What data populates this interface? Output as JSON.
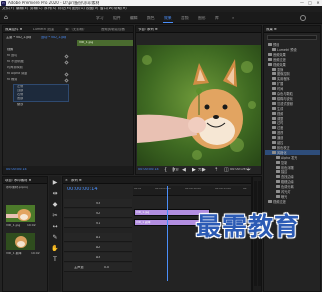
{
  "window": {
    "title": "Adobe Premiere Pro 2020 - D:\\pr\\备份\\水印素材",
    "controls": [
      "—",
      "□",
      "✕"
    ]
  },
  "menu": [
    "文件(F)",
    "编辑(E)",
    "剪辑(C)",
    "序列(S)",
    "标记(M)",
    "图形(G)",
    "视图(V)",
    "窗口(W)",
    "帮助(H)"
  ],
  "workspaces": {
    "items": [
      "学习",
      "组件",
      "编辑",
      "颜色",
      "效果",
      "音频",
      "图形",
      "库"
    ],
    "active_index": 4,
    "more": "»"
  },
  "effect_controls": {
    "tabs": [
      "效果控件 ≡",
      "Lumetri 范围",
      "源:（无剪辑）",
      "音频剪辑混合器"
    ],
    "header_source": "主要 * VID_1.jpg",
    "header_clip": "运动 * VID_1.jpg",
    "mini_clip": "VID_1.jpg",
    "sections": [
      {
        "label": "视频"
      },
      {
        "label": "fx 运动"
      },
      {
        "label": "fx 不透明度"
      },
      {
        "label": "时间重映射"
      },
      {
        "label": "fx Alpha 调整"
      },
      {
        "label": "fx 裁剪"
      },
      {
        "label": "左侧"
      },
      {
        "label": "顶部"
      },
      {
        "label": "右侧"
      },
      {
        "label": "底部"
      },
      {
        "label": "缩放"
      }
    ],
    "timecode": "00:00:00:14"
  },
  "program": {
    "tab": "节目: 序列 ≡",
    "timecode": "00:00:00:14",
    "fit": "适合",
    "quality": "完整",
    "duration": "00:00:19:02"
  },
  "effects_panel": {
    "title": "效果 ≡",
    "items": [
      "预设",
      "Lumetri 预设",
      "音频效果",
      "音频过渡",
      "视频效果",
      "变换",
      "图像控制",
      "实用程序",
      "扩展",
      "时间",
      "杂色与颗粒",
      "模糊与锐化",
      "沉浸式视频",
      "生成",
      "视频",
      "调整",
      "过时",
      "过渡",
      "透视",
      "通道",
      "键控",
      "颜色校正",
      "风格化",
      "Alpha 发光",
      "复制",
      "彩色浮雕",
      "描边",
      "查找边缘",
      "粗糙边缘",
      "色调分离",
      "闪光灯",
      "曝光",
      "视频过渡"
    ],
    "selected_index": 22
  },
  "project": {
    "tab": "项目: 水印素材 ≡",
    "file": "水印素材.prproj",
    "items": [
      {
        "label": "VID_1.jpg",
        "meta": "19:02"
      },
      {
        "label": "VID_1 副本",
        "meta": "19:02"
      }
    ]
  },
  "tools": [
    "▶",
    "⇹",
    "◆",
    "✂",
    "↔",
    "✎",
    "✋",
    "T"
  ],
  "timeline": {
    "tab": "序列 ≡",
    "timecode": "00:00:00:14",
    "ruler": [
      "00:00",
      "00:00:05:00",
      "00:00:10:00",
      "00:00:15:00",
      "00:"
    ],
    "tracks": [
      {
        "name": "V3"
      },
      {
        "name": "V2"
      },
      {
        "name": "V1"
      },
      {
        "name": "A1"
      },
      {
        "name": "A2"
      },
      {
        "name": "A3"
      },
      {
        "name": "主声道"
      }
    ],
    "clips": [
      {
        "label": "VID_1.jpg",
        "color": "#b28ee0"
      },
      {
        "label": "VID_1 副本",
        "color": "#b28ee0"
      }
    ],
    "master_value": "0.0"
  },
  "colors": {
    "accent": "#4b8ffa",
    "clip_video": "#b28ee0",
    "clip_green": "#4a6b2f",
    "watermark": "#2c5bb5"
  },
  "watermark": "最需教育"
}
